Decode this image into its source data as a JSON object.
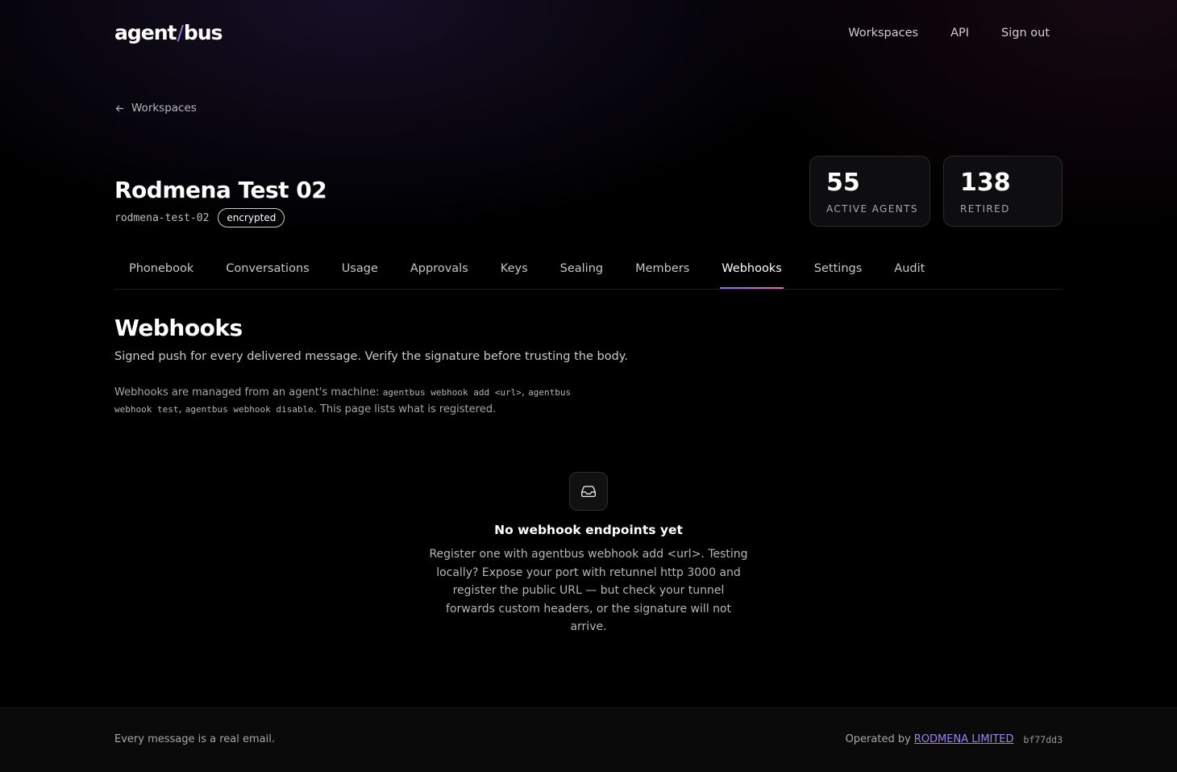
{
  "header": {
    "logo_left": "agent",
    "logo_slash": "/",
    "logo_right": "bus",
    "nav": [
      "Workspaces",
      "API",
      "Sign out"
    ]
  },
  "back_link": "Workspaces",
  "workspace": {
    "name": "Rodmena Test 02",
    "slug": "rodmena-test-02",
    "badge": "encrypted"
  },
  "stats": [
    {
      "value": "55",
      "label": "ACTIVE AGENTS"
    },
    {
      "value": "138",
      "label": "RETIRED"
    }
  ],
  "tabs": [
    {
      "label": "Phonebook"
    },
    {
      "label": "Conversations"
    },
    {
      "label": "Usage"
    },
    {
      "label": "Approvals"
    },
    {
      "label": "Keys"
    },
    {
      "label": "Sealing"
    },
    {
      "label": "Members"
    },
    {
      "label": "Webhooks",
      "active": true
    },
    {
      "label": "Settings"
    },
    {
      "label": "Audit"
    }
  ],
  "section": {
    "title": "Webhooks",
    "subtitle": "Signed push for every delivered message. Verify the signature before trusting the body.",
    "note_prefix": "Webhooks are managed from an agent's machine: ",
    "cmd_add": "agentbus webhook add <url>",
    "sep1": ", ",
    "cmd_test": "agentbus webhook test",
    "sep2": ", ",
    "cmd_disable": "agentbus webhook disable",
    "note_suffix": ". This page lists what is registered."
  },
  "empty_state": {
    "icon": "inbox-icon",
    "title": "No webhook endpoints yet",
    "body": "Register one with agentbus webhook add <url>. Testing locally? Expose your port with retunnel http 3000 and register the public URL — but check your tunnel forwards custom headers, or the signature will not arrive."
  },
  "footer": {
    "tagline": "Every message is a real email.",
    "operated_by": "Operated by",
    "company": "RODMENA LIMITED",
    "hash": "bf77dd3"
  },
  "colors": {
    "background": "#000000",
    "accent_purple": "#8a6cf0",
    "accent_pink": "#e06aa8",
    "link": "#9c84f0"
  }
}
